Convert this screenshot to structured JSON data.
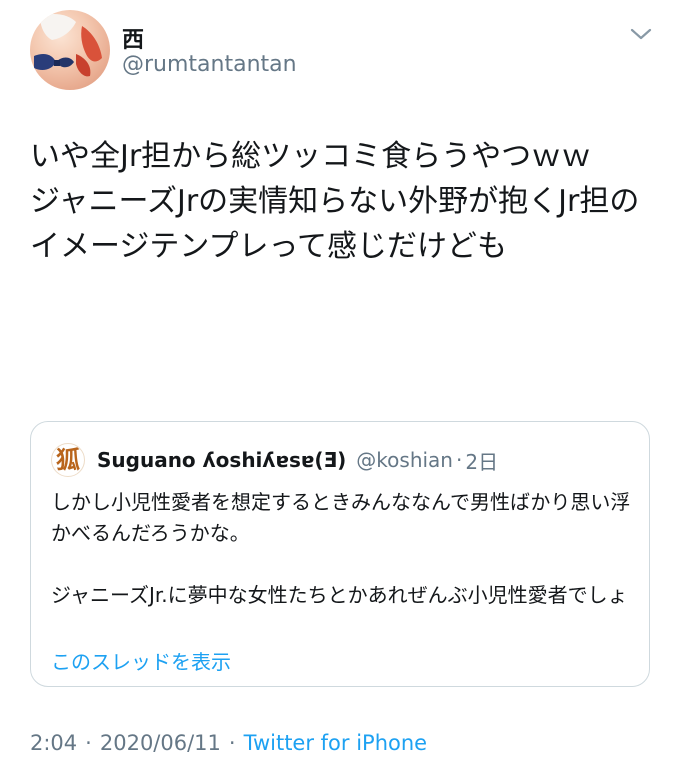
{
  "tweet": {
    "author": {
      "display_name": "西",
      "handle": "@rumtantantan"
    },
    "text": "いや全Jr担から総ツッコミ食らうやつｗｗ\nジャニーズJrの実情知らない外野が抱くJr担のイメージテンプレって感じだけども",
    "time": "2:04",
    "date": "2020/06/11",
    "source": "Twitter for iPhone",
    "meta_separator": "·",
    "more_icon": "chevron-down-icon"
  },
  "quoted_tweet": {
    "avatar_glyph": "狐",
    "display_name": "Suguano ʎoshiʎɐsɐ(Ǝ)",
    "handle": "@koshian",
    "separator": "·",
    "relative_time": "2日",
    "text": "しかし小児性愛者を想定するときみんななんで男性ばかり思い浮かべるんだろうかな。\n\nジャニーズJr.に夢中な女性たちとかあれぜんぶ小児性愛者でしょ",
    "thread_link": "このスレッドを表示"
  },
  "colors": {
    "text_primary": "#14171a",
    "text_secondary": "#657786",
    "link_blue": "#1da1f2",
    "border": "#cfd9de"
  }
}
